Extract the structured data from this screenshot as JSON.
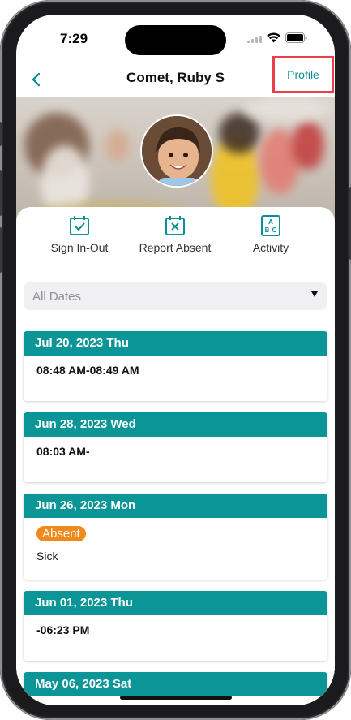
{
  "status": {
    "time": "7:29"
  },
  "nav": {
    "title": "Comet, Ruby S",
    "profile_label": "Profile"
  },
  "actions": [
    {
      "label": "Sign In-Out",
      "icon": "calendar-check-icon"
    },
    {
      "label": "Report Absent",
      "icon": "calendar-x-icon"
    },
    {
      "label": "Activity",
      "icon": "abc-blocks-icon"
    }
  ],
  "filter": {
    "selected": "All Dates"
  },
  "records": [
    {
      "date": "Jul 20, 2023 Thu",
      "time": "08:48 AM-08:49 AM"
    },
    {
      "date": "Jun 28, 2023 Wed",
      "time": "08:03 AM-"
    },
    {
      "date": "Jun 26, 2023 Mon",
      "status": "Absent",
      "reason": "Sick"
    },
    {
      "date": "Jun 01, 2023 Thu",
      "time": "-06:23 PM"
    },
    {
      "date": "May 06, 2023 Sat"
    }
  ],
  "colors": {
    "accent": "#0b9597",
    "absent_badge": "#f08a1c",
    "highlight_box": "#e8404a"
  }
}
